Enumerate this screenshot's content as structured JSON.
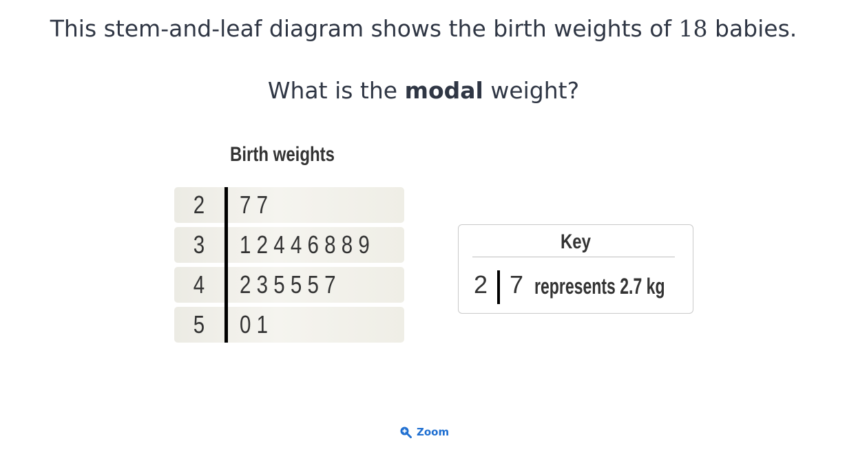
{
  "question": {
    "line1_prefix": "This stem-and-leaf diagram shows the birth weights of ",
    "count": "18",
    "line1_suffix": " babies.",
    "line2_prefix": "What is the ",
    "line2_bold": "modal",
    "line2_suffix": " weight?"
  },
  "diagram": {
    "title": "Birth weights",
    "rows": [
      {
        "stem": "2",
        "leaves": "7 7"
      },
      {
        "stem": "3",
        "leaves": "1 2 4 4 6 8 8 9"
      },
      {
        "stem": "4",
        "leaves": "2 3 5 5 5 7"
      },
      {
        "stem": "5",
        "leaves": "0 1"
      }
    ]
  },
  "key": {
    "title": "Key",
    "stem": "2",
    "leaf": "7",
    "text": "represents 2.7 kg"
  },
  "zoom": {
    "label": "Zoom",
    "icon": "zoom-in-icon",
    "color": "#1f6fd1"
  }
}
